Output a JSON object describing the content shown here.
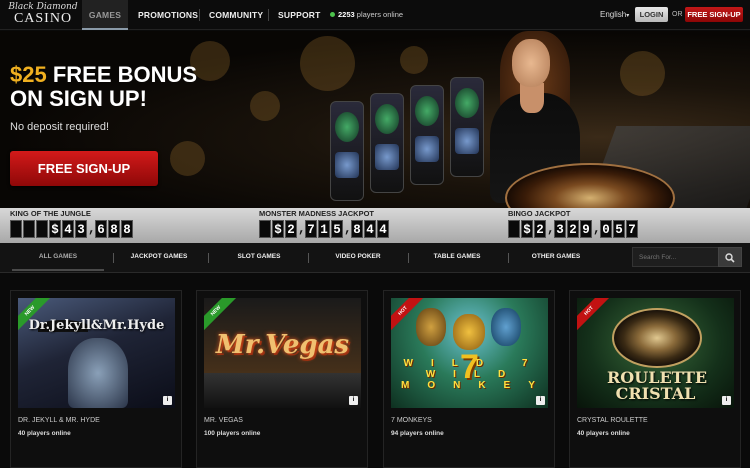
{
  "brand": {
    "line1": "Black Diamond",
    "line2": "CASINO"
  },
  "nav": {
    "games": "GAMES",
    "promotions": "PROMOTIONS",
    "community": "COMMUNITY",
    "support": "SUPPORT",
    "players_count": "2253",
    "players_suffix": "players online",
    "language": "English",
    "login": "LOGIN",
    "or": "OR",
    "signup": "FREE SIGN-UP"
  },
  "hero": {
    "amount": "$25",
    "title_rest": " FREE BONUS",
    "title_line2": "ON SIGN UP!",
    "subtitle": "No deposit required!",
    "button": "FREE SIGN-UP",
    "slides_total": 4,
    "active_slide": 1
  },
  "jackpots": [
    {
      "label": "KING OF THE JUNGLE",
      "digits": [
        " ",
        " ",
        " ",
        "$",
        "4",
        "3",
        ",",
        "6",
        "8",
        "8"
      ]
    },
    {
      "label": "MONSTER MADNESS JACKPOT",
      "digits": [
        " ",
        "$",
        "2",
        ",",
        "7",
        "1",
        "5",
        ",",
        "8",
        "4",
        "4"
      ]
    },
    {
      "label": "BINGO JACKPOT",
      "digits": [
        " ",
        "$",
        "2",
        ",",
        "3",
        "2",
        "9",
        ",",
        "0",
        "5",
        "7"
      ]
    }
  ],
  "categories": {
    "all": "ALL GAMES",
    "jackpot": "JACKPOT GAMES",
    "slot": "SLOT GAMES",
    "poker": "VIDEO POKER",
    "table": "TABLE GAMES",
    "other": "OTHER GAMES",
    "search_placeholder": "Search For..."
  },
  "games": [
    {
      "name": "DR. JEKYLL & MR. HYDE",
      "players": "40 players online",
      "badge": "NEW",
      "thumb_title": "Dr.Jekyll&Mr.Hyde"
    },
    {
      "name": "MR. VEGAS",
      "players": "100 players online",
      "badge": "NEW",
      "thumb_title": "Mr.Vegas"
    },
    {
      "name": "7 MONKEYS",
      "players": "94 players online",
      "badge": "HOT",
      "thumb_title": "WILD 7 WILD MONKEYS"
    },
    {
      "name": "CRYSTAL ROULETTE",
      "players": "40 players online",
      "badge": "HOT",
      "thumb_title": "ROULETTE CRISTAL"
    }
  ],
  "colors": {
    "accent_red": "#c31818",
    "bonus_gold": "#f0b020",
    "online_green": "#4cc24c",
    "new_badge": "#2a9a2a",
    "hot_badge": "#c21212"
  }
}
